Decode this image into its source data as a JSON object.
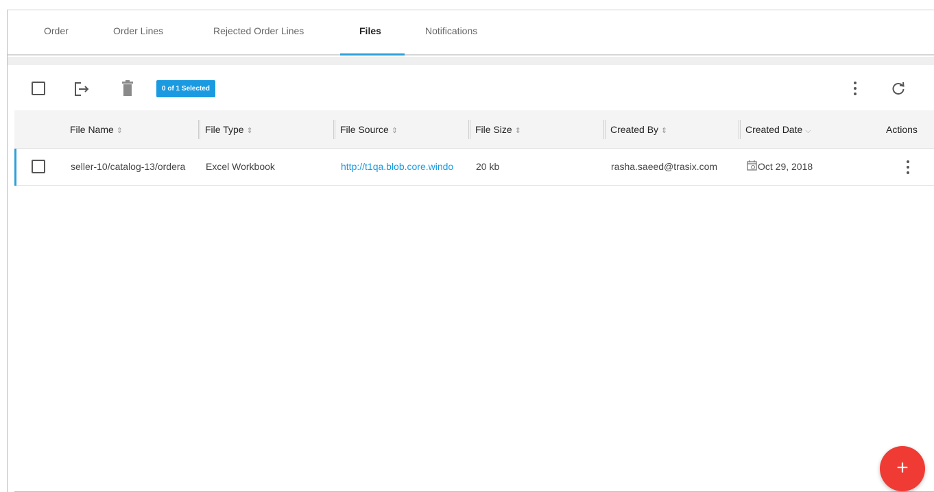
{
  "tabs": [
    {
      "label": "Order"
    },
    {
      "label": "Order Lines"
    },
    {
      "label": "Rejected Order Lines"
    },
    {
      "label": "Files",
      "active": true
    },
    {
      "label": "Notifications"
    }
  ],
  "toolbar": {
    "selection_badge": "0 of 1 Selected",
    "icons": [
      "select-all-checkbox",
      "export-icon",
      "trash-icon",
      "more-vert-icon",
      "refresh-icon"
    ]
  },
  "columns": [
    {
      "label": "File Name",
      "sort": "⇕"
    },
    {
      "label": "File Type",
      "sort": "⇕"
    },
    {
      "label": "File Source",
      "sort": "⇕"
    },
    {
      "label": "File Size",
      "sort": "⇕"
    },
    {
      "label": "Created By",
      "sort": "⇕"
    },
    {
      "label": "Created Date",
      "sort": "⌵"
    },
    {
      "label": "Actions"
    }
  ],
  "rows": [
    {
      "file_name": "seller-10/catalog-13/ordera",
      "file_type": "Excel Workbook",
      "file_source": "http://t1qa.blob.core.windo",
      "file_size": "20 kb",
      "created_by": "rasha.saeed@trasix.com",
      "created_date": "Oct 29, 2018"
    }
  ],
  "fab": {
    "label": "+"
  },
  "colors": {
    "accent": "#2b9fd8",
    "badge": "#1a9ae0",
    "fab": "#ef3b34"
  }
}
